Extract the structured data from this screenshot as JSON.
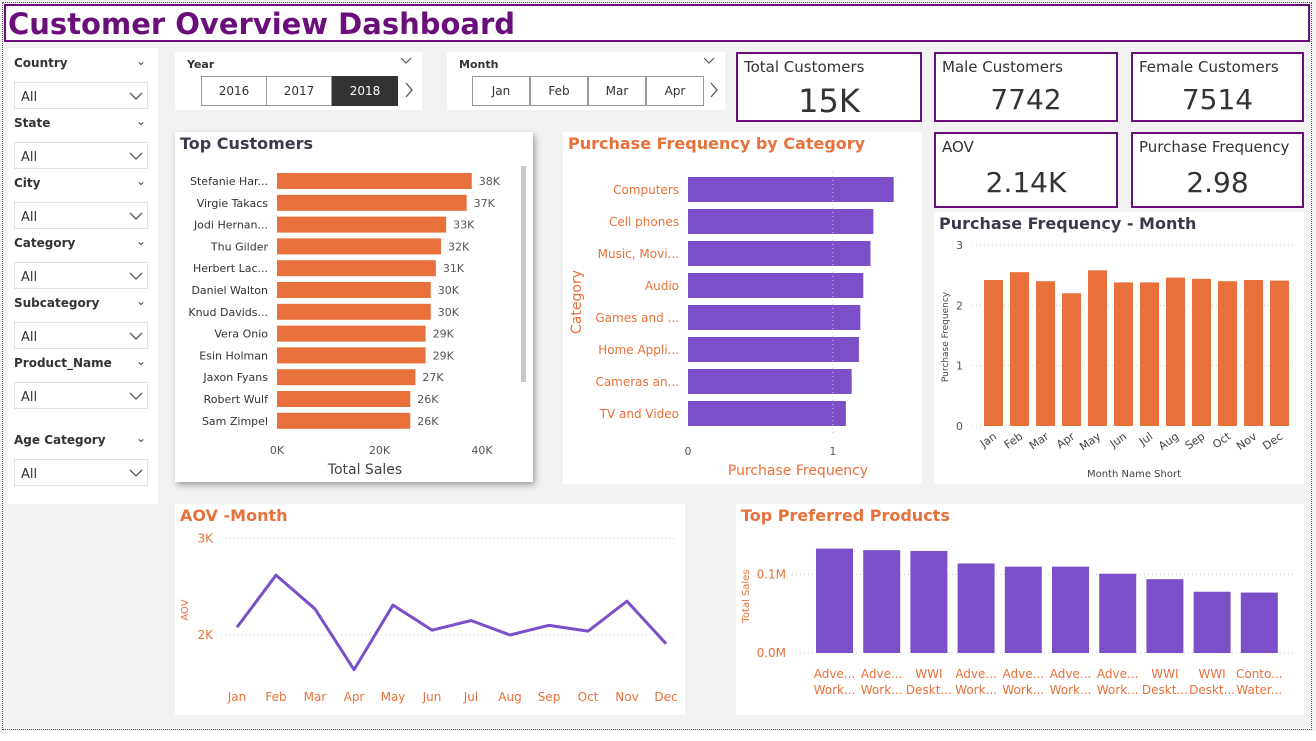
{
  "title": "Customer Overview Dashboard",
  "slicers": [
    {
      "label": "Country",
      "value": "All"
    },
    {
      "label": "State",
      "value": "All"
    },
    {
      "label": "City",
      "value": "All"
    },
    {
      "label": "Category",
      "value": "All"
    },
    {
      "label": "Subcategory",
      "value": "All"
    },
    {
      "label": "Product_Name",
      "value": "All"
    },
    {
      "label": "Age Category",
      "value": "All"
    }
  ],
  "year_slicer": {
    "label": "Year",
    "options": [
      "2016",
      "2017",
      "2018"
    ],
    "selected": "2018"
  },
  "month_slicer": {
    "label": "Month",
    "options": [
      "Jan",
      "Feb",
      "Mar",
      "Apr"
    ]
  },
  "kpis": {
    "total_customers": {
      "label": "Total Customers",
      "value": "15K"
    },
    "male_customers": {
      "label": "Male Customers",
      "value": "7742"
    },
    "female_customers": {
      "label": "Female Customers",
      "value": "7514"
    },
    "aov": {
      "label": "AOV",
      "value": "2.14K"
    },
    "purchase_frequency": {
      "label": "Purchase Frequency",
      "value": "2.98"
    }
  },
  "colors": {
    "brand": "#6a0f7a",
    "orange": "#e8703a",
    "purple": "#7b4fc8"
  },
  "chart_data": [
    {
      "id": "top_customers",
      "type": "bar",
      "orientation": "horizontal",
      "title": "Top Customers",
      "xlabel": "Total Sales",
      "ylabel": "",
      "categories": [
        "Stefanie Har...",
        "Virgie Takacs",
        "Jodi Hernan...",
        "Thu Gilder",
        "Herbert Lac...",
        "Daniel Walton",
        "Knud Davids...",
        "Vera Onio",
        "Esin Holman",
        "Jaxon Fyans",
        "Robert Wulf",
        "Sam Zimpel"
      ],
      "values": [
        38000,
        37000,
        33000,
        32000,
        31000,
        30000,
        30000,
        29000,
        29000,
        27000,
        26000,
        26000
      ],
      "data_labels": [
        "38K",
        "37K",
        "33K",
        "32K",
        "31K",
        "30K",
        "30K",
        "29K",
        "29K",
        "27K",
        "26K",
        "26K"
      ],
      "xticks": [
        "0K",
        "20K",
        "40K"
      ],
      "xlim": [
        0,
        40000
      ]
    },
    {
      "id": "purchase_freq_category",
      "type": "bar",
      "orientation": "horizontal",
      "title": "Purchase Frequency by Category",
      "xlabel": "Purchase Frequency",
      "ylabel": "Category",
      "categories": [
        "Computers",
        "Cell phones",
        "Music, Movi...",
        "Audio",
        "Games and ...",
        "Home Appli...",
        "Cameras an...",
        "TV and Video"
      ],
      "values": [
        1.42,
        1.28,
        1.26,
        1.21,
        1.19,
        1.18,
        1.13,
        1.09
      ],
      "xticks": [
        "0",
        "1"
      ],
      "xlim": [
        0,
        1.45
      ]
    },
    {
      "id": "purchase_freq_month",
      "type": "bar",
      "title": "Purchase Frequency - Month",
      "xlabel": "Month Name Short",
      "ylabel": "Purchase Frequency",
      "categories": [
        "Jan",
        "Feb",
        "Mar",
        "Apr",
        "May",
        "Jun",
        "Jul",
        "Aug",
        "Sep",
        "Oct",
        "Nov",
        "Dec"
      ],
      "values": [
        2.42,
        2.55,
        2.4,
        2.2,
        2.58,
        2.38,
        2.38,
        2.46,
        2.44,
        2.4,
        2.42,
        2.41
      ],
      "yticks": [
        "0",
        "1",
        "2",
        "3"
      ],
      "ylim": [
        0,
        3
      ]
    },
    {
      "id": "aov_month",
      "type": "line",
      "title": "AOV -Month",
      "xlabel": "",
      "ylabel": "AOV",
      "categories": [
        "Jan",
        "Feb",
        "Mar",
        "Apr",
        "May",
        "Jun",
        "Jul",
        "Aug",
        "Sep",
        "Oct",
        "Nov",
        "Dec"
      ],
      "values": [
        2080,
        2620,
        2270,
        1640,
        2310,
        2050,
        2150,
        2000,
        2100,
        2040,
        2350,
        1910
      ],
      "yticks": [
        "2K",
        "3K"
      ],
      "ylim": [
        1600,
        3000
      ]
    },
    {
      "id": "top_products",
      "type": "bar",
      "title": "Top Preferred Products",
      "xlabel": "",
      "ylabel": "Total Sales",
      "categories": [
        [
          "Adve...",
          "Work..."
        ],
        [
          "Adve...",
          "Work..."
        ],
        [
          "WWI",
          "Deskt..."
        ],
        [
          "Adve...",
          "Work..."
        ],
        [
          "Adve...",
          "Work..."
        ],
        [
          "Adve...",
          "Work..."
        ],
        [
          "Adve...",
          "Work..."
        ],
        [
          "WWI",
          "Deskt..."
        ],
        [
          "WWI",
          "Deskt..."
        ],
        [
          "Conto...",
          "Water..."
        ]
      ],
      "values": [
        0.133,
        0.131,
        0.13,
        0.114,
        0.11,
        0.11,
        0.101,
        0.094,
        0.078,
        0.077
      ],
      "yticks": [
        "0.0M",
        "0.1M"
      ],
      "ylim": [
        0,
        0.135
      ]
    }
  ]
}
